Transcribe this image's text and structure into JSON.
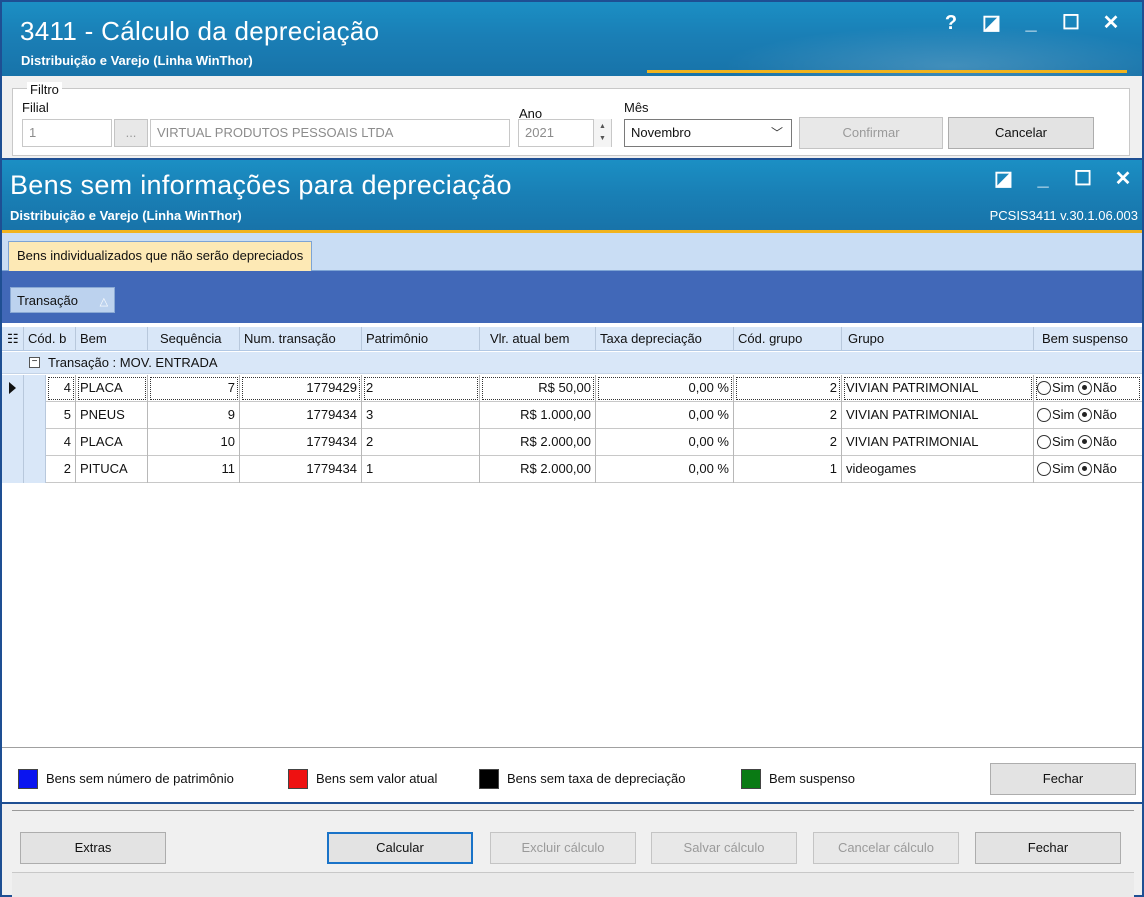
{
  "main_window": {
    "title": "3411 - Cálculo da depreciação",
    "subtitle": "Distribuição e Varejo (Linha WinThor)",
    "controls": {
      "help": "?",
      "restore": "◪",
      "minimize": "_",
      "maximize": "☐",
      "close": "✕"
    }
  },
  "filtro": {
    "legend": "Filtro",
    "filial_label": "Filial",
    "filial_code": "1",
    "filial_lookup_label": "...",
    "filial_name": "VIRTUAL PRODUTOS PESSOAIS LTDA",
    "ano_label": "Ano",
    "ano_value": "2021",
    "mes_label": "Mês",
    "mes_value": "Novembro",
    "confirmar_label": "Confirmar",
    "cancelar_label": "Cancelar"
  },
  "dialog": {
    "title": "Bens sem informações para depreciação",
    "subtitle": "Distribuição e Varejo (Linha WinThor)",
    "version": "PCSIS3411  v.30.1.06.003",
    "controls": {
      "restore": "◪",
      "minimize": "_",
      "maximize": "☐",
      "close": "✕"
    },
    "tab_label": "Bens individualizados que não serão depreciados",
    "group_chip": "Transação",
    "columns": [
      "Cód. b",
      "Bem",
      "Sequência",
      "Num. transação",
      "Patrimônio",
      "Vlr. atual bem",
      "Taxa depreciação",
      "Cód. grupo",
      "Grupo",
      "Bem suspenso"
    ],
    "group_row": "Transação : MOV. ENTRADA",
    "rows": [
      {
        "cod": "4",
        "bem": "PLACA",
        "seq": "7",
        "num": "1779429",
        "patrimonio": "2",
        "valor": "R$ 50,00",
        "taxa": "0,00 %",
        "cod_grupo": "2",
        "grupo": "VIVIAN PATRIMONIAL",
        "sim": "Sim",
        "nao": "Não"
      },
      {
        "cod": "5",
        "bem": "PNEUS",
        "seq": "9",
        "num": "1779434",
        "patrimonio": "3",
        "valor": "R$ 1.000,00",
        "taxa": "0,00 %",
        "cod_grupo": "2",
        "grupo": "VIVIAN PATRIMONIAL",
        "sim": "Sim",
        "nao": "Não"
      },
      {
        "cod": "4",
        "bem": "PLACA",
        "seq": "10",
        "num": "1779434",
        "patrimonio": "2",
        "valor": "R$ 2.000,00",
        "taxa": "0,00 %",
        "cod_grupo": "2",
        "grupo": "VIVIAN PATRIMONIAL",
        "sim": "Sim",
        "nao": "Não"
      },
      {
        "cod": "2",
        "bem": "PITUCA",
        "seq": "11",
        "num": "1779434",
        "patrimonio": "1",
        "valor": "R$ 2.000,00",
        "taxa": "0,00 %",
        "cod_grupo": "1",
        "grupo": "videogames",
        "sim": "Sim",
        "nao": "Não"
      }
    ],
    "legend": [
      {
        "label": "Bens sem número de patrimônio",
        "color": "#0a14f0"
      },
      {
        "label": "Bens sem valor atual",
        "color": "#ee1111"
      },
      {
        "label": "Bens sem taxa de depreciação",
        "color": "#000000"
      },
      {
        "label": "Bem suspenso",
        "color": "#0a7a14"
      }
    ],
    "fechar_label": "Fechar"
  },
  "bottom_buttons": {
    "extras": "Extras",
    "calcular": "Calcular",
    "excluir": "Excluir cálculo",
    "salvar": "Salvar cálculo",
    "cancelar": "Cancelar cálculo",
    "fechar": "Fechar"
  }
}
